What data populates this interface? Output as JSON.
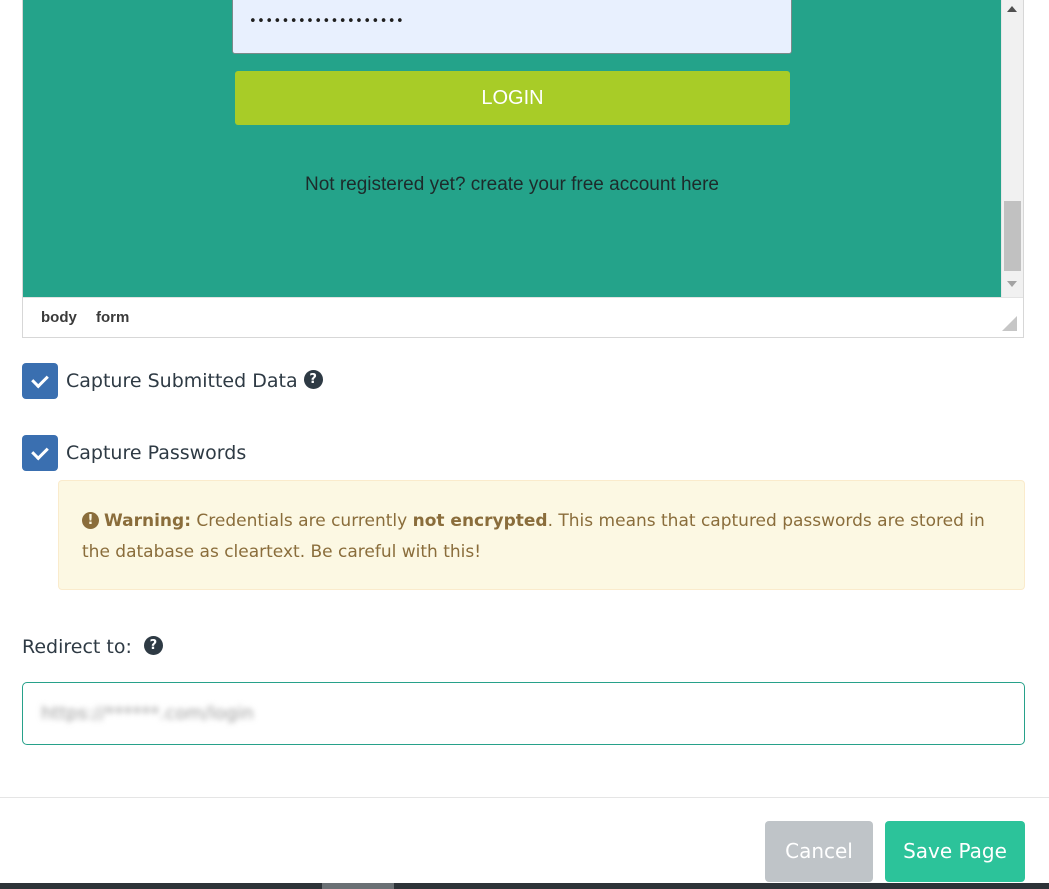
{
  "editor": {
    "preview": {
      "password_dots": "•••••••••••••••••••",
      "login_button": "LOGIN",
      "register_prompt": "Not registered yet?",
      "register_link": "create your free account here"
    },
    "statusbar": {
      "path": [
        "body",
        "form"
      ]
    }
  },
  "options": {
    "capture_submitted": {
      "label": "Capture Submitted Data",
      "checked": true
    },
    "capture_passwords": {
      "label": "Capture Passwords",
      "checked": true
    }
  },
  "warning": {
    "title": "Warning:",
    "text_before": "Credentials are currently",
    "emphasis": "not encrypted",
    "text_after": ". This means that captured passwords are stored in the database as cleartext. Be careful with this!"
  },
  "redirect": {
    "label": "Redirect to:",
    "value": "https://******.com/login"
  },
  "footer": {
    "cancel_label": "Cancel",
    "save_label": "Save Page"
  },
  "colors": {
    "preview_bg": "#24a38a",
    "login_button": "#a8cc27",
    "checkbox": "#3a6fb0",
    "warning_bg": "#fcf8e3",
    "warning_text": "#8a6d3b",
    "save_button": "#2cc39a",
    "cancel_button": "#bfc4c8"
  }
}
